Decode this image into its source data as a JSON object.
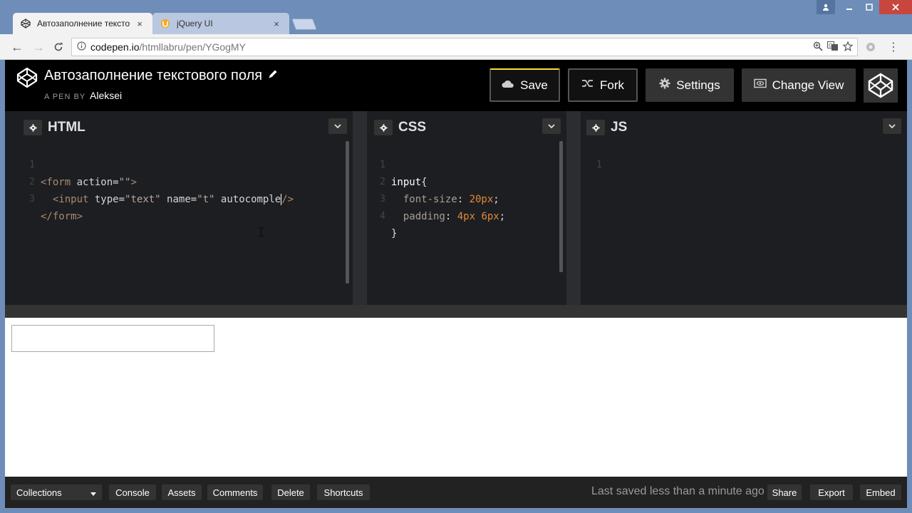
{
  "browser": {
    "tabs": [
      {
        "title": "Автозаполнение тексто",
        "icon": "codepen-icon"
      },
      {
        "title": "jQuery UI",
        "icon": "jquery-ui-icon"
      }
    ],
    "url_host": "codepen.io",
    "url_path": "/htmllabru/pen/YGogMY",
    "close_glyph": "×",
    "back_glyph": "←",
    "forward_glyph": "→",
    "reload_glyph": "C",
    "menu_glyph": "⋮"
  },
  "header": {
    "pen_title": "Автозаполнение текстового поля",
    "pen_by_prefix": "A PEN BY",
    "author": "Aleksei",
    "buttons": {
      "save": "Save",
      "fork": "Fork",
      "settings": "Settings",
      "change_view": "Change View"
    }
  },
  "editors": {
    "html": {
      "label": "HTML",
      "lines": [
        "1",
        "2",
        "3"
      ],
      "l1_tag_open": "<form",
      "l1_attr": " action",
      "l1_eq": "=",
      "l1_val": "\"\"",
      "l1_close": ">",
      "l2_indent": "  ",
      "l2_tag_open": "<input",
      "l2_attr1": " type",
      "l2_val1": "\"text\"",
      "l2_attr2": " name",
      "l2_val2": "\"t\"",
      "l2_attr3": " autocomple",
      "l2_close": "/>",
      "l3_tag": "</form>"
    },
    "css": {
      "label": "CSS",
      "lines": [
        "1",
        "2",
        "3",
        "4"
      ],
      "selector": "input",
      "brace_open": "{",
      "prop1": "font-size",
      "val1": "20px",
      "prop2": "padding",
      "val2": "4px 6px",
      "brace_close": "}",
      "colon": ": ",
      "semicolon": ";",
      "indent": "  "
    },
    "js": {
      "label": "JS",
      "lines": [
        "1"
      ]
    }
  },
  "footer": {
    "collections": "Collections",
    "console": "Console",
    "assets": "Assets",
    "comments": "Comments",
    "delete": "Delete",
    "shortcuts": "Shortcuts",
    "saved_status": "Last saved less than a minute ago",
    "share": "Share",
    "export": "Export",
    "embed": "Embed"
  },
  "colors": {
    "accent_save": "#ffdd40",
    "editor_bg": "#1d1e22",
    "number": "#e08a34"
  }
}
